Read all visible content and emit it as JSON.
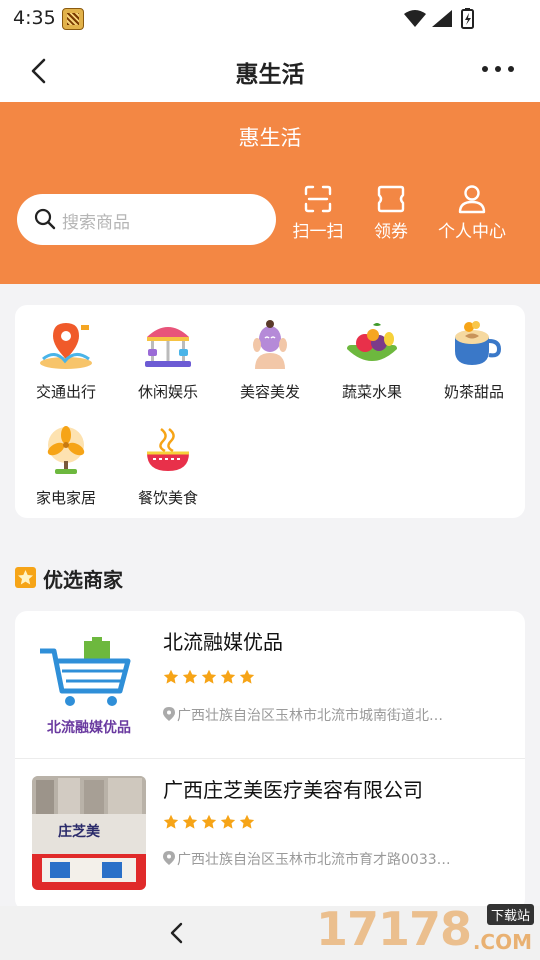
{
  "status_bar": {
    "time": "4:35"
  },
  "nav": {
    "title": "惠生活"
  },
  "header": {
    "title": "惠生活",
    "search_placeholder": "搜索商品",
    "actions": [
      {
        "label": "扫一扫",
        "icon": "scan-icon"
      },
      {
        "label": "领券",
        "icon": "coupon-icon"
      },
      {
        "label": "个人中心",
        "icon": "user-icon"
      }
    ]
  },
  "categories": [
    {
      "label": "交通出行",
      "icon": "transport-icon"
    },
    {
      "label": "休闲娱乐",
      "icon": "carousel-icon"
    },
    {
      "label": "美容美发",
      "icon": "beauty-icon"
    },
    {
      "label": "蔬菜水果",
      "icon": "fruit-icon"
    },
    {
      "label": "奶茶甜品",
      "icon": "coffee-icon"
    },
    {
      "label": "家电家居",
      "icon": "fan-icon"
    },
    {
      "label": "餐饮美食",
      "icon": "noodles-icon"
    }
  ],
  "section": {
    "title": "优选商家"
  },
  "merchants": [
    {
      "name": "北流融媒优品",
      "rating": 5,
      "address": "广西壮族自治区玉林市北流市城南街道北…",
      "logo_text": "北流融媒优品"
    },
    {
      "name": "广西庄芝美医疗美容有限公司",
      "rating": 5,
      "address": "广西壮族自治区玉林市北流市育才路0033…",
      "photo_sign": "庄芝美"
    }
  ],
  "watermark": {
    "brand": "17178",
    "sub": ".COM",
    "tag": "下载站"
  },
  "colors": {
    "accent": "#f38744",
    "star": "#f6a417",
    "text": "#222222",
    "muted": "#9a9a9a"
  }
}
